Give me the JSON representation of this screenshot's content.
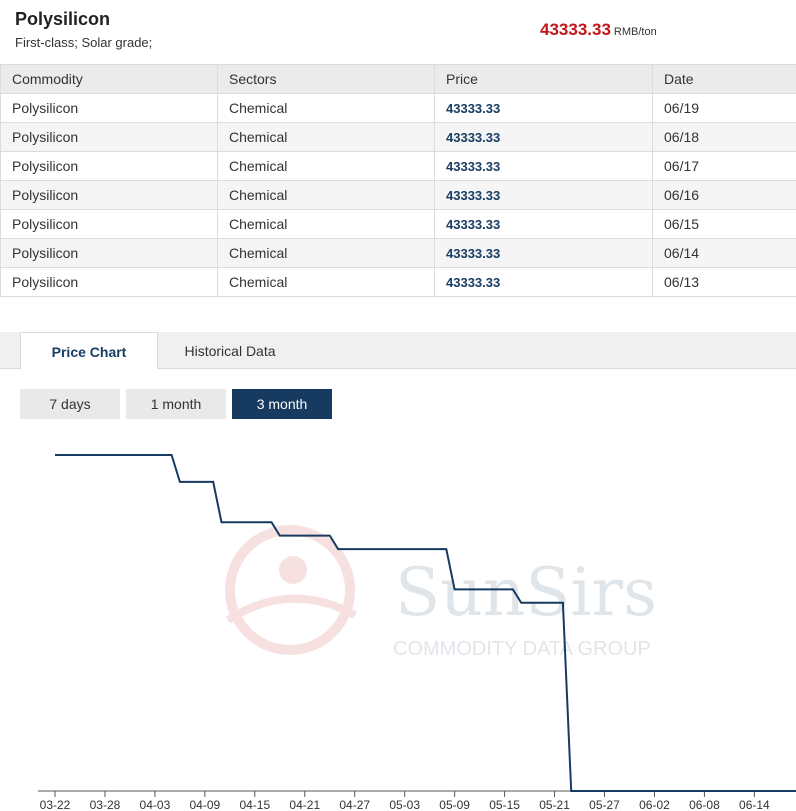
{
  "header": {
    "title": "Polysilicon",
    "subtitle": "First-class; Solar grade;",
    "price": "43333.33",
    "unit": "RMB/ton"
  },
  "table": {
    "columns": [
      "Commodity",
      "Sectors",
      "Price",
      "Date"
    ],
    "rows": [
      {
        "commodity": "Polysilicon",
        "sector": "Chemical",
        "price": "43333.33",
        "date": "06/19"
      },
      {
        "commodity": "Polysilicon",
        "sector": "Chemical",
        "price": "43333.33",
        "date": "06/18"
      },
      {
        "commodity": "Polysilicon",
        "sector": "Chemical",
        "price": "43333.33",
        "date": "06/17"
      },
      {
        "commodity": "Polysilicon",
        "sector": "Chemical",
        "price": "43333.33",
        "date": "06/16"
      },
      {
        "commodity": "Polysilicon",
        "sector": "Chemical",
        "price": "43333.33",
        "date": "06/15"
      },
      {
        "commodity": "Polysilicon",
        "sector": "Chemical",
        "price": "43333.33",
        "date": "06/14"
      },
      {
        "commodity": "Polysilicon",
        "sector": "Chemical",
        "price": "43333.33",
        "date": "06/13"
      }
    ]
  },
  "tabs": [
    {
      "label": "Price Chart",
      "active": true
    },
    {
      "label": "Historical Data",
      "active": false
    }
  ],
  "ranges": [
    {
      "label": "7 days",
      "selected": false
    },
    {
      "label": "1 month",
      "selected": false
    },
    {
      "label": "3 month",
      "selected": true
    }
  ],
  "colors": {
    "accent": "#173a60",
    "line": "#173a60",
    "price_red": "#c0161a"
  },
  "watermark": {
    "brand": "SunSirs",
    "tagline": "COMMODITY DATA GROUP"
  },
  "chart_data": {
    "type": "line",
    "step": true,
    "x_dates": [
      "03-22",
      "04-05",
      "04-06",
      "04-10",
      "04-11",
      "04-17",
      "04-18",
      "04-24",
      "04-25",
      "05-08",
      "05-09",
      "05-16",
      "05-17",
      "05-22",
      "05-23",
      "06-19"
    ],
    "y_levels": [
      10,
      9.2,
      8.0,
      7.6,
      7.2,
      6.0,
      5.6,
      3.6,
      0
    ],
    "values_relative": [
      10,
      10,
      9.2,
      9.2,
      8.0,
      8.0,
      7.6,
      7.6,
      7.2,
      7.2,
      6.0,
      6.0,
      5.6,
      5.6,
      0,
      0
    ],
    "xlim": [
      "03-22",
      "06-19"
    ],
    "x_ticks": [
      "03-22",
      "03-28",
      "04-03",
      "04-09",
      "04-15",
      "04-21",
      "04-27",
      "05-03",
      "05-09",
      "05-15",
      "05-21",
      "05-27",
      "06-02",
      "06-08",
      "06-14"
    ],
    "y_ticks": [],
    "grid": false,
    "legend": "none"
  }
}
